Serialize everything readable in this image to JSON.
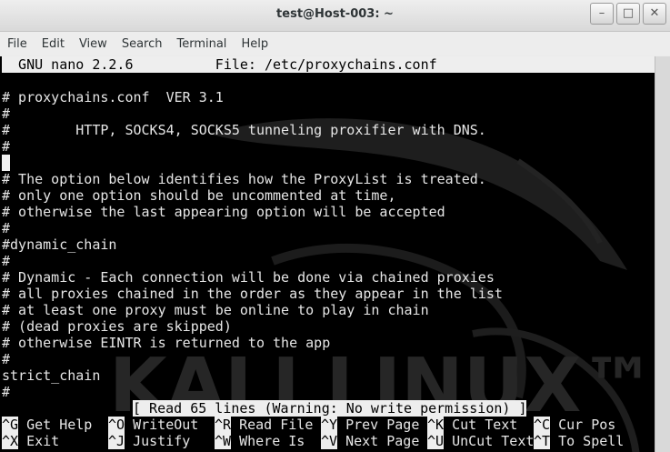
{
  "window": {
    "title": "test@Host-003: ~",
    "buttons": [
      "–",
      "□",
      "✕"
    ]
  },
  "menu": [
    "File",
    "Edit",
    "View",
    "Search",
    "Terminal",
    "Help"
  ],
  "nano": {
    "header": "  GNU nano 2.2.6          File: /etc/proxychains.conf",
    "lines": [
      "",
      "# proxychains.conf  VER 3.1",
      "#",
      "#        HTTP, SOCKS4, SOCKS5 tunneling proxifier with DNS.",
      "#",
      "",
      "# The option below identifies how the ProxyList is treated.",
      "# only one option should be uncommented at time,",
      "# otherwise the last appearing option will be accepted",
      "#",
      "#dynamic_chain",
      "#",
      "# Dynamic - Each connection will be done via chained proxies",
      "# all proxies chained in the order as they appear in the list",
      "# at least one proxy must be online to play in chain",
      "# (dead proxies are skipped)",
      "# otherwise EINTR is returned to the app",
      "#",
      "strict_chain",
      "#"
    ],
    "status": "[ Read 65 lines (Warning: No write permission) ]",
    "shortcuts_row1": [
      {
        "key": "^G",
        "label": " Get Help  "
      },
      {
        "key": "^O",
        "label": " WriteOut  "
      },
      {
        "key": "^R",
        "label": " Read File "
      },
      {
        "key": "^Y",
        "label": " Prev Page "
      },
      {
        "key": "^K",
        "label": " Cut Text  "
      },
      {
        "key": "^C",
        "label": " Cur Pos"
      }
    ],
    "shortcuts_row2": [
      {
        "key": "^X",
        "label": " Exit      "
      },
      {
        "key": "^J",
        "label": " Justify   "
      },
      {
        "key": "^W",
        "label": " Where Is  "
      },
      {
        "key": "^V",
        "label": " Next Page "
      },
      {
        "key": "^U",
        "label": " UnCut Text"
      },
      {
        "key": "^T",
        "label": " To Spell"
      }
    ]
  },
  "watermark": "KALI LINUX™",
  "colors": {
    "terminal_bg": "#000000",
    "terminal_fg": "#e6e6e6",
    "inverse_bg": "#eeeeee"
  }
}
